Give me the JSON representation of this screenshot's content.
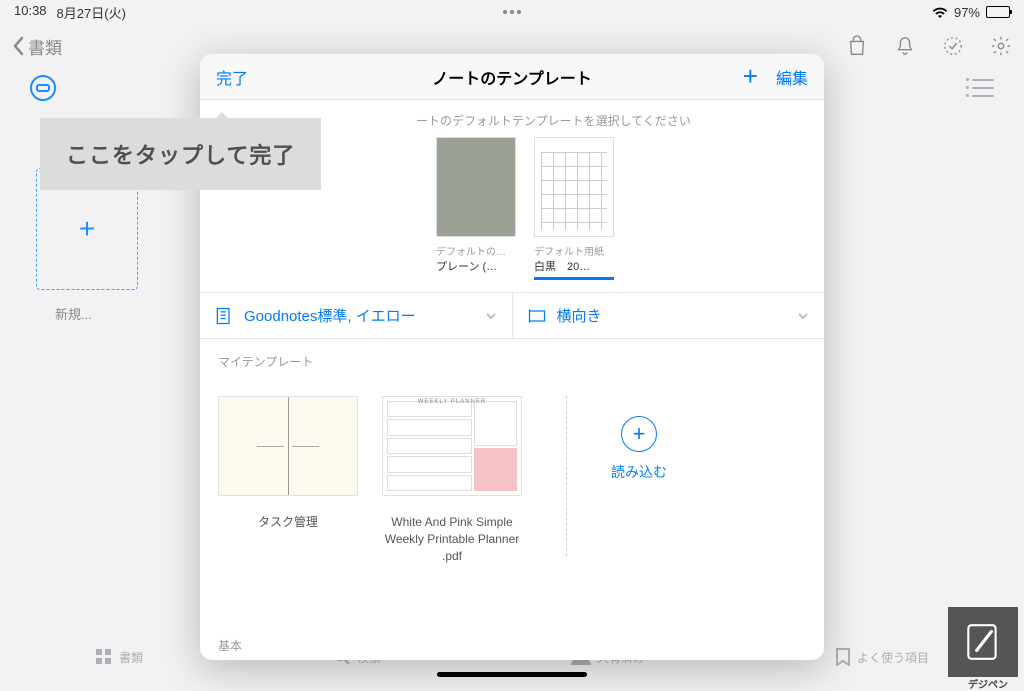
{
  "status": {
    "time": "10:38",
    "date": "8月27日(火)",
    "battery_pct": "97%"
  },
  "nav": {
    "back_label": "書類"
  },
  "sidebar": {
    "new_label": "新規..."
  },
  "bottom_tabs": {
    "docs": "書類",
    "search": "検索",
    "shared": "共有済み",
    "favorites": "よく使う項目"
  },
  "modal": {
    "done": "完了",
    "title": "ノートのテンプレート",
    "edit": "編集",
    "default_hint": "ートのデフォルトテンプレートを選択してください",
    "defaults": [
      {
        "caption1": "デフォルトの…",
        "caption2": "プレーン (…"
      },
      {
        "caption1": "デフォルト用紙",
        "caption2": "白黒　20…"
      }
    ],
    "filter_paper": "Goodnotes標準, イエロー",
    "filter_orient": "横向き",
    "mytemplates_label": "マイテンプレート",
    "templates": [
      {
        "name": "タスク管理"
      },
      {
        "name": "White And Pink Simple Weekly Printable  Planner .pdf"
      }
    ],
    "import_label": "読み込む",
    "basic_label": "基本"
  },
  "annotation": {
    "text": "ここをタップして完了"
  },
  "watermark": {
    "label": "デジペン"
  }
}
